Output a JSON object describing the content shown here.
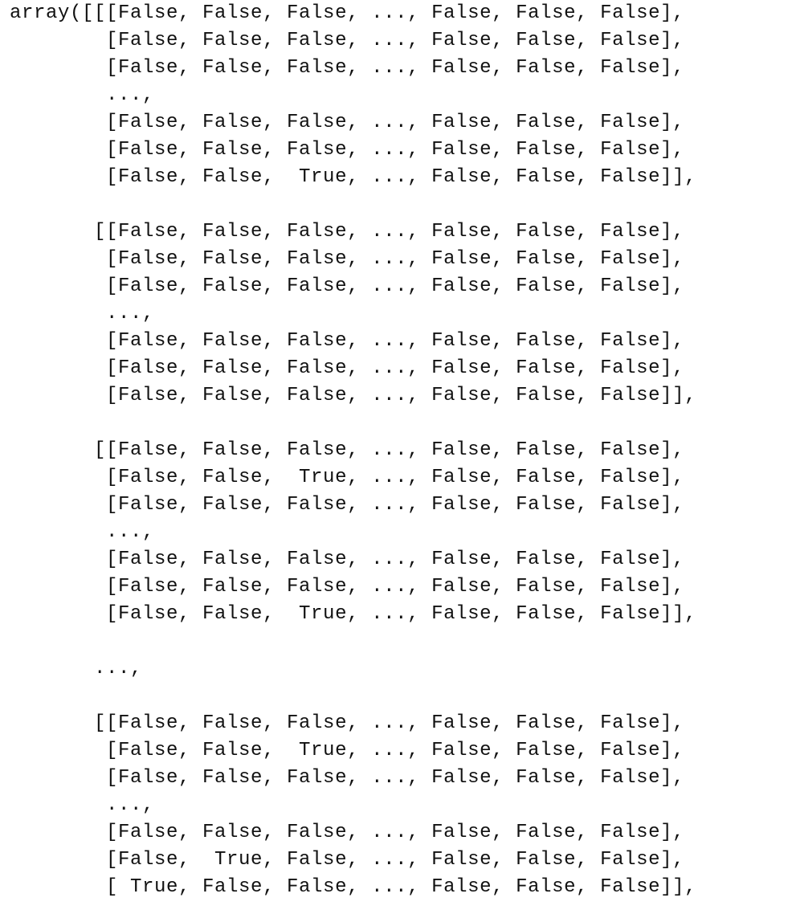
{
  "output": {
    "lines": [
      "array([[[False, False, False, ..., False, False, False],",
      "        [False, False, False, ..., False, False, False],",
      "        [False, False, False, ..., False, False, False],",
      "        ...,",
      "        [False, False, False, ..., False, False, False],",
      "        [False, False, False, ..., False, False, False],",
      "        [False, False,  True, ..., False, False, False]],",
      "",
      "       [[False, False, False, ..., False, False, False],",
      "        [False, False, False, ..., False, False, False],",
      "        [False, False, False, ..., False, False, False],",
      "        ...,",
      "        [False, False, False, ..., False, False, False],",
      "        [False, False, False, ..., False, False, False],",
      "        [False, False, False, ..., False, False, False]],",
      "",
      "       [[False, False, False, ..., False, False, False],",
      "        [False, False,  True, ..., False, False, False],",
      "        [False, False, False, ..., False, False, False],",
      "        ...,",
      "        [False, False, False, ..., False, False, False],",
      "        [False, False, False, ..., False, False, False],",
      "        [False, False,  True, ..., False, False, False]],",
      "",
      "       ...,",
      "",
      "       [[False, False, False, ..., False, False, False],",
      "        [False, False,  True, ..., False, False, False],",
      "        [False, False, False, ..., False, False, False],",
      "        ...,",
      "        [False, False, False, ..., False, False, False],",
      "        [False,  True, False, ..., False, False, False],",
      "        [ True, False, False, ..., False, False, False]],"
    ]
  }
}
